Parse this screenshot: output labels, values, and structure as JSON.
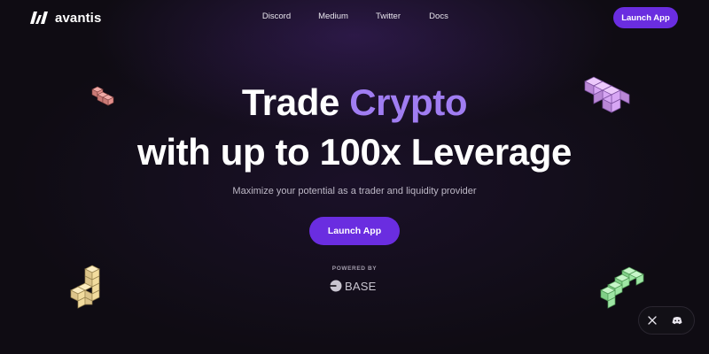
{
  "brand": {
    "name": "avantis",
    "logo_icon": "avantis-logo-icon"
  },
  "nav": {
    "items": [
      "Discord",
      "Medium",
      "Twitter",
      "Docs"
    ],
    "launch_label": "Launch App"
  },
  "hero": {
    "title_plain": "Trade",
    "title_accent": "Crypto",
    "title_line2": "with up to 100x Leverage",
    "subtitle": "Maximize your potential as a trader and liquidity provider",
    "cta_label": "Launch App"
  },
  "powered": {
    "label": "POWERED BY",
    "brand": "BASE",
    "icon": "base-logo-icon"
  },
  "social": [
    {
      "icon": "x-twitter-icon",
      "label": "X"
    },
    {
      "icon": "discord-icon",
      "label": "Discord"
    }
  ],
  "colors": {
    "background": "#0f0c13",
    "accent": "#a07df2",
    "button": "#6a2de0",
    "block_red": "#e38f8b",
    "block_purple": "#d7a6f4",
    "block_yellow": "#f2dc9e",
    "block_green": "#9ee6a4"
  }
}
